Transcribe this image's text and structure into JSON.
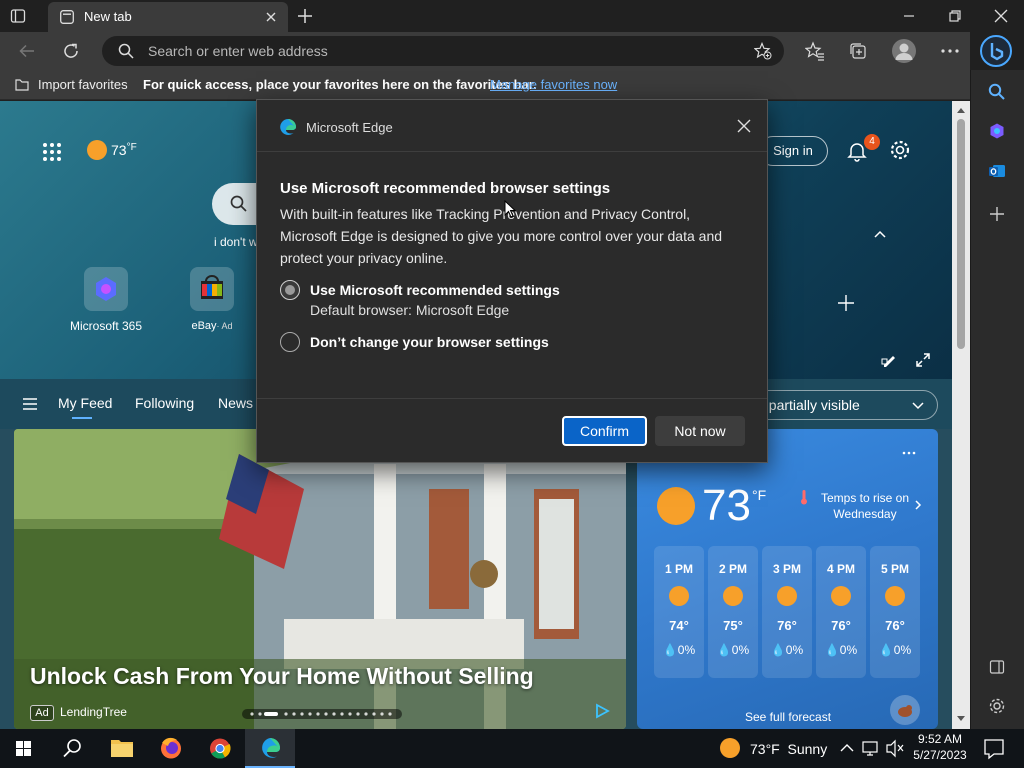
{
  "window": {
    "tab_title": "New tab"
  },
  "address_bar": {
    "placeholder": "Search or enter web address"
  },
  "favorites_bar": {
    "import_label": "Import favorites",
    "hint_text": "For quick access, place your favorites here on the favorites bar.",
    "manage_link": "Manage favorites now"
  },
  "newtab": {
    "weather_temp": "73",
    "weather_unit": "°F",
    "search_hint": "i don't w",
    "sign_in": "Sign in",
    "notification_count": "4",
    "quick_links": [
      {
        "label": "Microsoft 365"
      },
      {
        "label": "eBay",
        "ad": "· Ad"
      }
    ],
    "feed_tabs": [
      "My Feed",
      "Following",
      "News"
    ],
    "content_visibility": "t partially visible"
  },
  "ad_card": {
    "headline": "Unlock Cash From Your Home Without Selling",
    "ad_badge": "Ad",
    "source": "LendingTree"
  },
  "weather_card": {
    "temp": "73",
    "unit": "°F",
    "forecast_note": "Temps to rise on Wednesday",
    "hours": [
      {
        "time": "1 PM",
        "temp": "74°",
        "precip": "0%"
      },
      {
        "time": "2 PM",
        "temp": "75°",
        "precip": "0%"
      },
      {
        "time": "3 PM",
        "temp": "76°",
        "precip": "0%"
      },
      {
        "time": "4 PM",
        "temp": "76°",
        "precip": "0%"
      },
      {
        "time": "5 PM",
        "temp": "76°",
        "precip": "0%"
      }
    ],
    "full_forecast": "See full forecast"
  },
  "dialog": {
    "app_name": "Microsoft Edge",
    "heading": "Use Microsoft recommended browser settings",
    "body": "With built-in features like Tracking Prevention and Privacy Control, Microsoft Edge is designed to give you more control over your data and protect your privacy online.",
    "option1_label": "Use Microsoft recommended settings",
    "option1_sub": "Default browser: Microsoft Edge",
    "option2_label": "Don’t change your browser settings",
    "confirm": "Confirm",
    "not_now": "Not now"
  },
  "taskbar": {
    "weather": "73°F  Sunny",
    "time": "9:52 AM",
    "date": "5/27/2023"
  },
  "colors": {
    "accent": "#0a64c8",
    "link": "#6bb4ff",
    "badge": "#e8541c",
    "sun": "#f7a02a"
  }
}
